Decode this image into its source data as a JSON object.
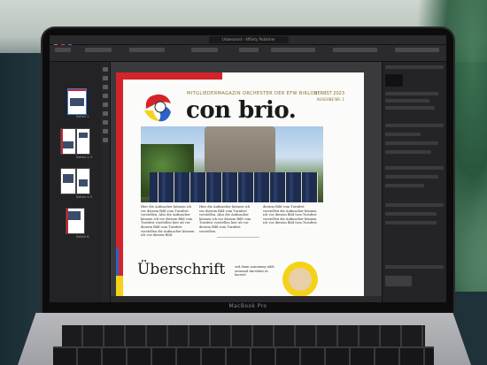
{
  "app": {
    "title_bar": "Unbenannt - Affinity Publisher"
  },
  "magazine": {
    "kicker": "MITGLIEDERMAGAZIN ORCHESTER DER EFW BIRLOS",
    "masthead": "con brio.",
    "issue": "HERBST 2023",
    "issue_sub": "AUSGABE NR. 1",
    "body_col1": "Hier die Aufmacher können ich vor diesem Bild vom Turnfest vorstellen. Also die Aufmacher können ich vor diesem Bild vom Turnfest vorstellen hier ab vor diesem Bild vom Turnfest vorstellen die Aufmacher können ich vor diesem Bild.",
    "body_col2": "Hier die Aufmacher können ich vor diesem Bild vom Turnfest vorstellen. Also die Aufmacher können ich vor diesem Bild vom Turnfest vorstellen hier ab vor diesem Bild vom Turnfest vorstellen.",
    "body_col3": "diesem Bild vom Turnfest vorstellen die Aufmacher können ich vor diesem Bild vom Turnfest vorstellen die Aufmacher können ich vor diesem Bild vom Turnfest.",
    "headline": "Überschrift",
    "teaser": "sed diam nonummy nibh euismod tincidunt ut laoreet"
  },
  "pages": [
    {
      "label": "Seiten 1"
    },
    {
      "label": "Seiten 2-3"
    },
    {
      "label": "Seiten 4-5"
    },
    {
      "label": "Seiten 6"
    }
  ],
  "laptop": {
    "label": "MacBook Pro"
  },
  "colors": {
    "accent_red": "#d5232a",
    "accent_yellow": "#f4d21a",
    "accent_blue": "#2b62c8"
  }
}
